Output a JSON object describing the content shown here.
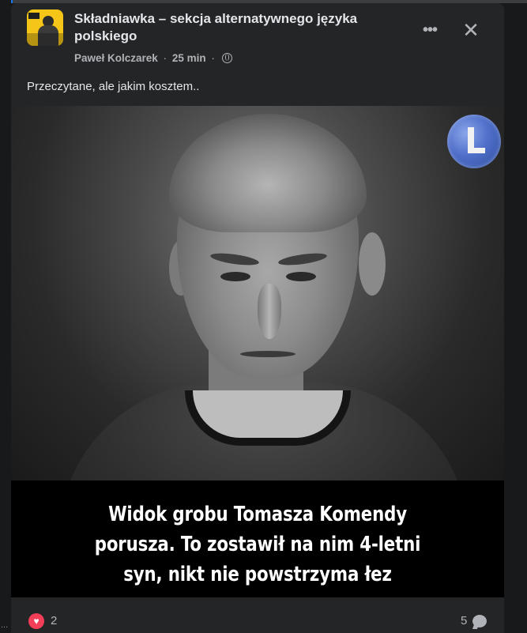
{
  "post": {
    "group_name": "Składniawka – sekcja alternatywnego języka polskiego",
    "author": "Paweł Kolczarek",
    "separator": "·",
    "time": "25 min",
    "separator2": "·",
    "text": "Przeczytane, ale jakim kosztem..",
    "more_icon": "more-icon",
    "close_icon": "close-icon"
  },
  "image": {
    "caption": "Widok grobu Tomasza Komendy porusza. To zostawił na nim 4-letni syn, nikt nie powstrzyma łez",
    "logo_icon": "logo-badge",
    "palette": "grayscale"
  },
  "footer": {
    "reactions": "2",
    "reaction_icon": "heart-icon",
    "reaction_color": "#f33e58",
    "comments": "5",
    "comment_icon": "comment-icon"
  },
  "edge": {
    "dots": "..."
  },
  "colors": {
    "background": "#18191a",
    "card": "#242526",
    "primary_text": "#e4e6eb",
    "secondary_text": "#b0b3b8",
    "accent": "#1877f2"
  }
}
